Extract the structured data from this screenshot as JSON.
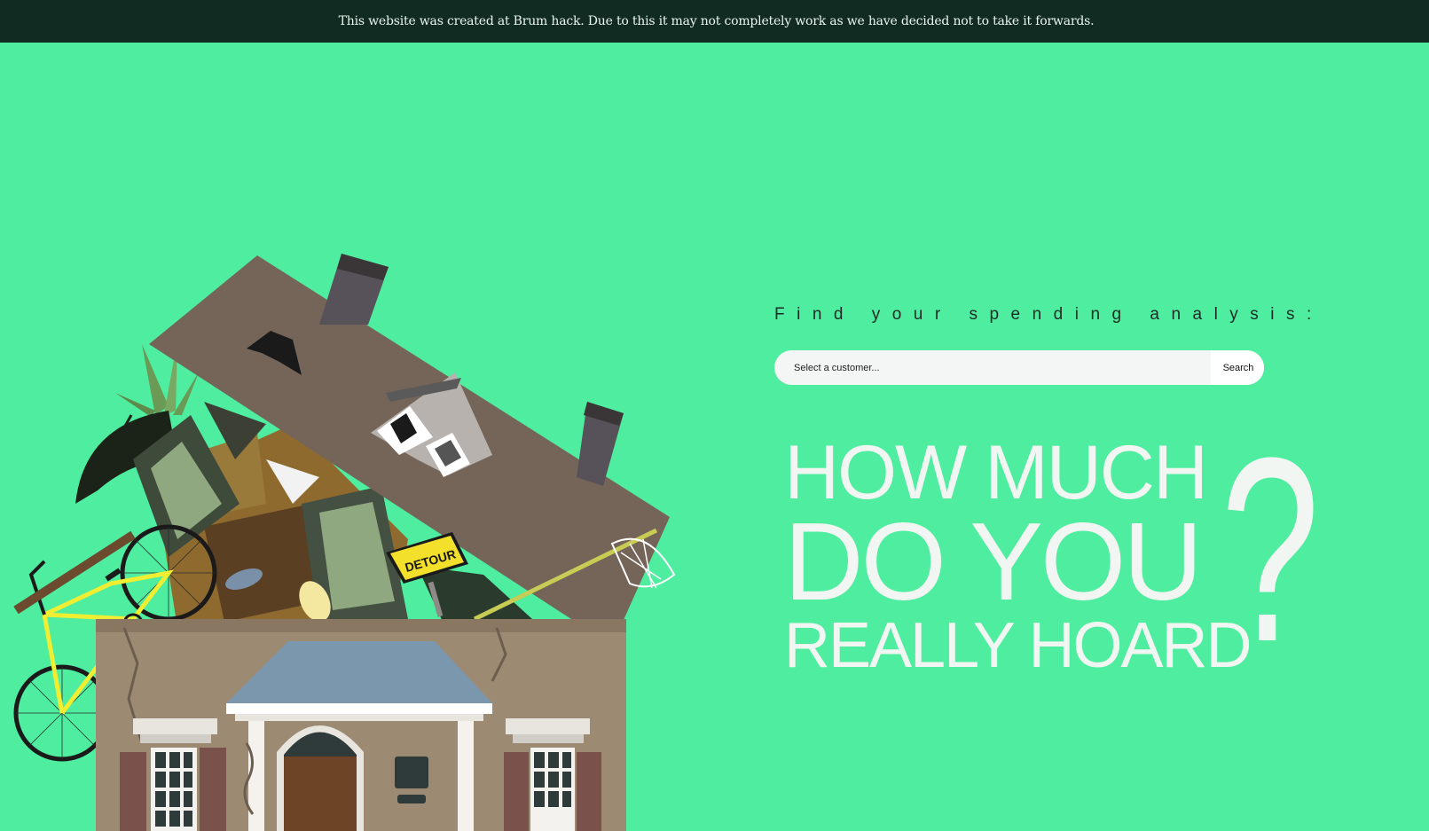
{
  "banner": {
    "text": "This website was created at Brum hack. Due to this it may not completely work as we have decided not to take it forwards."
  },
  "search": {
    "subtitle": "Find your spending analysis:",
    "placeholder": "Select a customer...",
    "button_label": "Search"
  },
  "headline": {
    "line1": "HOW MUCH",
    "line2": "DO YOU",
    "line3": "REALLY HOARD",
    "question_mark": "?"
  },
  "illustration": {
    "sign_text": "DETOUR"
  },
  "colors": {
    "background": "#4eed9f",
    "banner": "#112b22",
    "headline": "#f2f6f3"
  }
}
